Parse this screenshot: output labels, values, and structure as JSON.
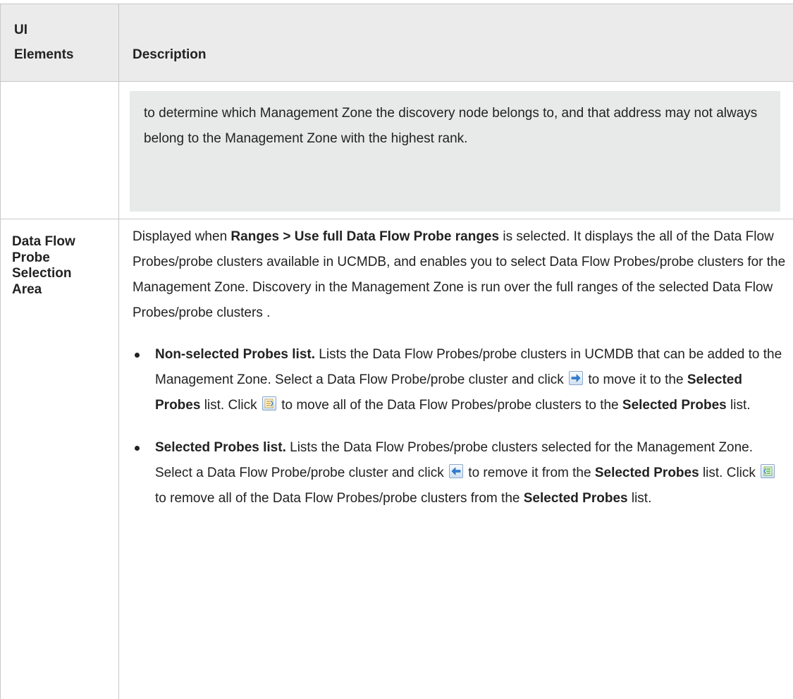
{
  "table": {
    "header": {
      "col1_line1": "UI",
      "col1_line2": "Elements",
      "col2": "Description"
    },
    "note": {
      "text": "to determine which Management Zone the discovery node belongs to, and that address may not always belong to the Management Zone with the highest rank."
    },
    "probe_row": {
      "term_lines": [
        "Data Flow",
        "Probe",
        "Selection",
        "Area"
      ],
      "intro": {
        "pre": "Displayed when ",
        "bold": "Ranges > Use full Data Flow Probe ranges",
        "post": " is selected. It displays the all of the Data Flow Probes/probe clusters available in UCMDB, and enables you to select Data Flow Probes/probe clusters for the Management Zone. Discovery in the Management Zone is run over the full ranges of the selected Data Flow Probes/probe clusters ."
      },
      "bullet1": {
        "title": "Non-selected Probes list.",
        "text1": " Lists the Data Flow Probes/probe clusters in UCMDB that can be added to the Management Zone. Select a Data Flow Probe/probe cluster and click ",
        "text2": " to move it to the ",
        "bold1": "Selected Probes",
        "text3": " list. Click ",
        "text4": " to move all of the Data Flow Probes/probe clusters to the ",
        "bold2": "Selected Probes",
        "text5": " list."
      },
      "bullet2": {
        "title": "Selected Probes list.",
        "text1": " Lists the Data Flow Probes/probe clusters selected for the Management Zone. Select a Data Flow Probe/probe cluster and click ",
        "text2": " to remove it from the ",
        "bold1": "Selected Probes",
        "text3": " list. Click ",
        "text4": " to remove all of the Data Flow Probes/probe clusters from the ",
        "bold2": "Selected Probes",
        "text5": " list."
      }
    }
  },
  "icons": {
    "move_right": "arrow-right-icon",
    "move_all_right": "move-all-right-icon",
    "move_left": "arrow-left-icon",
    "move_all_left": "move-all-left-icon"
  }
}
